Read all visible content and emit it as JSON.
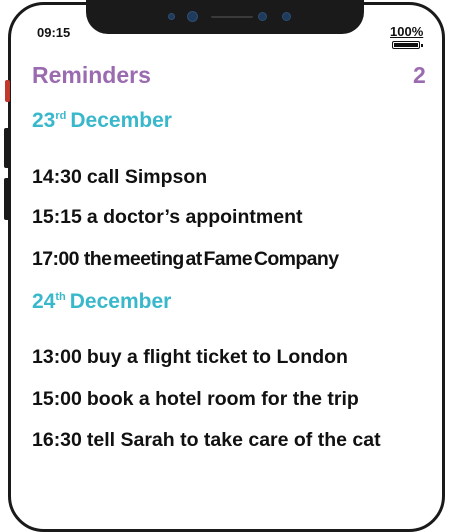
{
  "status": {
    "time": "09:15",
    "battery": "100%"
  },
  "header": {
    "title": "Reminders",
    "count": "2"
  },
  "days": [
    {
      "day": "23",
      "suffix": "rd",
      "month": "December",
      "items": [
        {
          "time": "14:30",
          "task": "call Simpson"
        },
        {
          "time": "15:15",
          "task": "a doctor’s appointment"
        },
        {
          "time": "17:00",
          "task": "the meeting at Fame Company"
        }
      ]
    },
    {
      "day": "24",
      "suffix": "th",
      "month": "December",
      "items": [
        {
          "time": "13:00",
          "task": "buy a flight ticket to London"
        },
        {
          "time": "15:00",
          "task": "book a hotel room for the trip"
        },
        {
          "time": "16:30",
          "task": "tell Sarah to take care of the cat"
        }
      ]
    }
  ],
  "icons": {
    "battery": "battery-full-icon",
    "camera": "front-camera-icon"
  }
}
